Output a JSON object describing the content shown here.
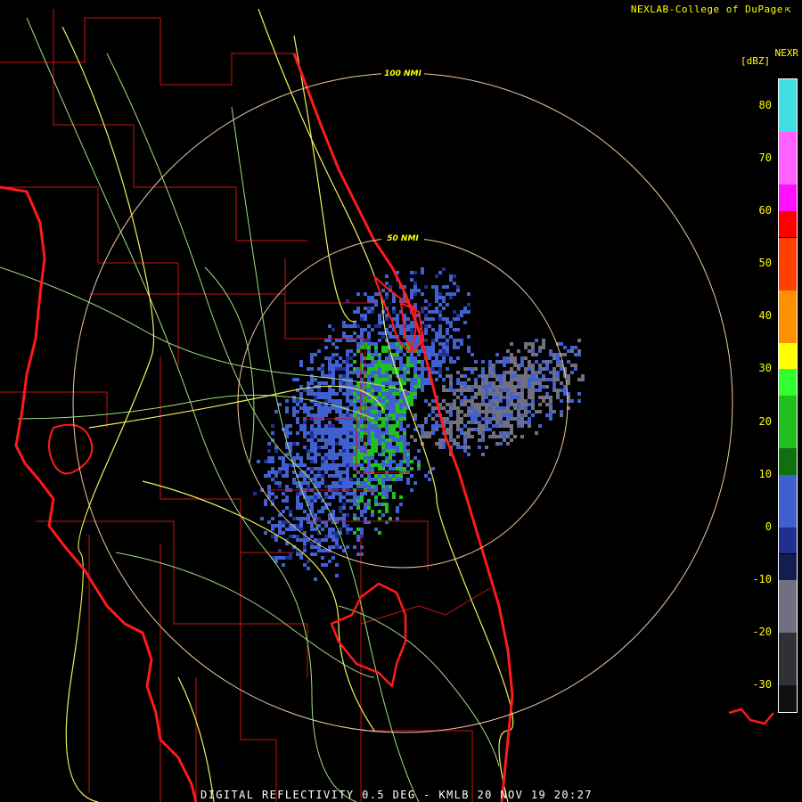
{
  "header": {
    "credit": "NEXLAB-College of DuPage",
    "credit_icon": "cursor-arrow-icon"
  },
  "legend": {
    "product": "NEXR",
    "unit": "[dBZ]",
    "ticks": [
      "80",
      "70",
      "60",
      "50",
      "40",
      "30",
      "20",
      "10",
      "0",
      "-10",
      "-20",
      "-30"
    ],
    "ranges": [
      {
        "from": 75,
        "to": 85,
        "color": "#40e0e0"
      },
      {
        "from": 65,
        "to": 75,
        "color": "#ff60ff"
      },
      {
        "from": 60,
        "to": 65,
        "color": "#ff10ff"
      },
      {
        "from": 55,
        "to": 60,
        "color": "#ff0000"
      },
      {
        "from": 45,
        "to": 55,
        "color": "#ff4000"
      },
      {
        "from": 35,
        "to": 45,
        "color": "#ff9000"
      },
      {
        "from": 30,
        "to": 35,
        "color": "#ffff00"
      },
      {
        "from": 25,
        "to": 30,
        "color": "#30ff30"
      },
      {
        "from": 15,
        "to": 25,
        "color": "#20c020"
      },
      {
        "from": 10,
        "to": 15,
        "color": "#107010"
      },
      {
        "from": 0,
        "to": 10,
        "color": "#4060d0"
      },
      {
        "from": -5,
        "to": 0,
        "color": "#203090"
      },
      {
        "from": -10,
        "to": -5,
        "color": "#151c50"
      },
      {
        "from": -20,
        "to": -10,
        "color": "#707080"
      },
      {
        "from": -30,
        "to": -20,
        "color": "#303038"
      },
      {
        "from": -35,
        "to": -30,
        "color": "#101010"
      }
    ],
    "min": -35,
    "max": 85
  },
  "map": {
    "range_rings": [
      {
        "label": "50 NMI",
        "nmi": 50
      },
      {
        "label": "100 NMI",
        "nmi": 100
      }
    ],
    "colors": {
      "coast": "#ff1a1a",
      "county": "#c81414",
      "highway": "#f0f060",
      "road": "#a0e080",
      "ring": "#f0c8a0"
    }
  },
  "footer": {
    "caption": "DIGITAL REFLECTIVITY 0.5 DEG - KMLB 20 NOV 19 20:27"
  }
}
